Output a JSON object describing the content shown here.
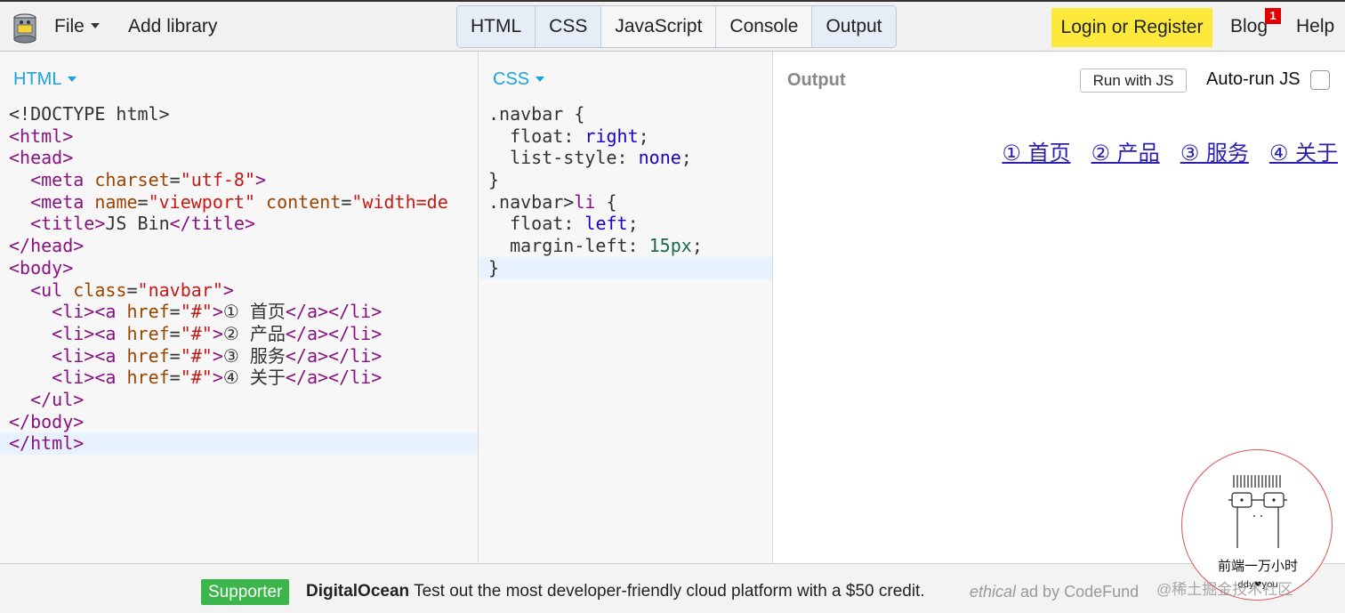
{
  "topbar": {
    "file_label": "File",
    "add_library_label": "Add library",
    "tabs": [
      {
        "label": "HTML"
      },
      {
        "label": "CSS"
      },
      {
        "label": "JavaScript"
      },
      {
        "label": "Console"
      },
      {
        "label": "Output"
      }
    ],
    "login_label": "Login or Register",
    "blog_label": "Blog",
    "blog_badge": "1",
    "help_label": "Help"
  },
  "html_pane": {
    "label": "HTML",
    "lines": [
      "<!DOCTYPE html>",
      "<html>",
      "<head>",
      "  <meta charset=\"utf-8\">",
      "  <meta name=\"viewport\" content=\"width=de",
      "  <title>JS Bin</title>",
      "</head>",
      "<body>",
      "  <ul class=\"navbar\">",
      "    <li><a href=\"#\">① 首页</a></li>",
      "    <li><a href=\"#\">② 产品</a></li>",
      "    <li><a href=\"#\">③ 服务</a></li>",
      "    <li><a href=\"#\">④ 关于</a></li>",
      "  </ul>",
      "</body>",
      "</html>"
    ]
  },
  "css_pane": {
    "label": "CSS",
    "lines": [
      ".navbar {",
      "  float: right;",
      "  list-style: none;",
      "}",
      ".navbar>li {",
      "  float: left;",
      "  margin-left: 15px;",
      "}"
    ]
  },
  "output_pane": {
    "title": "Output",
    "run_label": "Run with JS",
    "autorun_label": "Auto-run JS",
    "autorun_checked": false,
    "nav_links": [
      "① 首页",
      "② 产品",
      "③ 服务",
      "④ 关于"
    ]
  },
  "ad": {
    "supporter_label": "Supporter",
    "brand": "DigitalOcean",
    "text": " Test out the most developer-friendly cloud platform with a $50 credit.",
    "ethical": "ethical",
    "by": " ad by CodeFund"
  },
  "watermark": {
    "stamp_text": "前端一万小时",
    "stamp_sub": "ddy❤you",
    "site": "@稀土掘金技术社区"
  },
  "colors": {
    "accent": "#1aa1e6",
    "login_bg": "#fde93b",
    "supporter_bg": "#3cb54a",
    "badge": "#e00000"
  }
}
